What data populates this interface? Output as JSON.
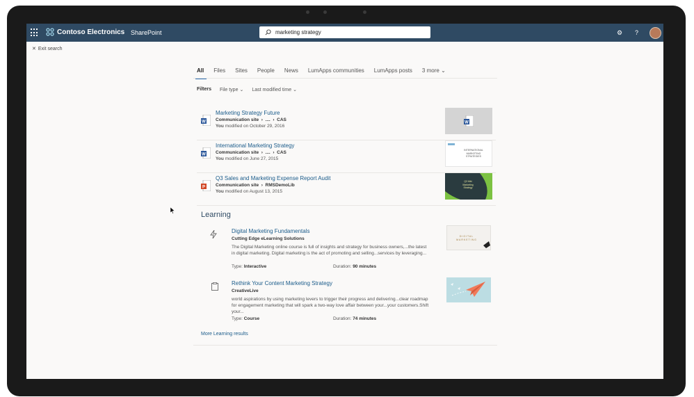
{
  "suite": {
    "org_name": "Contoso Electronics",
    "app_name": "SharePoint"
  },
  "search": {
    "value": "marketing strategy"
  },
  "exit_search": {
    "label": "Exit search"
  },
  "tabs": [
    {
      "label": "All"
    },
    {
      "label": "Files"
    },
    {
      "label": "Sites"
    },
    {
      "label": "People"
    },
    {
      "label": "News"
    },
    {
      "label": "LumApps communities"
    },
    {
      "label": "LumApps posts"
    },
    {
      "label": "3 more"
    }
  ],
  "filters": {
    "label": "Filters",
    "file_type": "File type",
    "last_modified": "Last modified time"
  },
  "results": [
    {
      "title": "Marketing Strategy Future",
      "site": "Communication site",
      "ellipsis": "....",
      "folder": "CAS",
      "who": "You",
      "modified": "modified on October 29, 2016",
      "icon": "word-doc-icon"
    },
    {
      "title": "International Marketing Strategy",
      "site": "Communication site",
      "ellipsis": "....",
      "folder": "CAS",
      "who": "You",
      "modified": "modified on June 27, 2015",
      "icon": "word-doc-icon"
    },
    {
      "title": "Q3 Sales and Marketing Expense Report Audit",
      "site": "Communication site",
      "ellipsis": "",
      "folder": "RMSDemoLib",
      "who": "You",
      "modified": "modified on August 13, 2015",
      "icon": "powerpoint-doc-icon"
    }
  ],
  "thumbs": {
    "intl": "INTERNATIONAL MARKETING STRATEGIES",
    "q3": "Q3 Mkt Marketing Strategy",
    "digital": "DIGITAL MARKETING"
  },
  "learning": {
    "section_title": "Learning",
    "items": [
      {
        "title": "Digital Marketing Fundamentals",
        "source": "Cutting Edge eLearning Solutions",
        "desc": "The Digital Marketing online course is full of insights and strategy for business owners,...the latest in digital marketing. Digital marketing is the act of promoting and selling...services by leveraging...",
        "type_label": "Type:",
        "type_value": "Interactive",
        "duration_label": "Duration:",
        "duration_value": "90 minutes"
      },
      {
        "title": "Rethink Your Content Marketing Strategy",
        "source": "CreativeLive",
        "desc": "world aspirations by using marketing levers to trigger their progress and delivering...clear roadmap for engagement marketing that will spark a two-way love affair between your...your customers.Shift your...",
        "type_label": "Type:",
        "type_value": "Course",
        "duration_label": "Duration:",
        "duration_value": "74 minutes"
      }
    ],
    "more_label": "More Learning results"
  },
  "colors": {
    "suitebar": "#2f4a63",
    "link": "#1a5b8a",
    "accent": "#2b6cb0"
  }
}
